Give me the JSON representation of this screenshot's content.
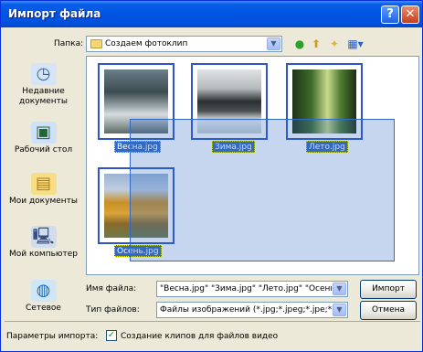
{
  "window": {
    "title": "Импорт файла"
  },
  "folder_row": {
    "label": "Папка:",
    "current_folder": "Создаем фотоклип"
  },
  "places": [
    {
      "label": "Недавние документы",
      "icon": "recent-documents-icon"
    },
    {
      "label": "Рабочий стол",
      "icon": "desktop-icon"
    },
    {
      "label": "Мои документы",
      "icon": "my-documents-icon"
    },
    {
      "label": "Мой компьютер",
      "icon": "my-computer-icon"
    },
    {
      "label": "Сетевое",
      "icon": "network-icon"
    }
  ],
  "files": [
    {
      "name": "Весна.jpg",
      "selected": true
    },
    {
      "name": "Зима.jpg",
      "selected": true
    },
    {
      "name": "Лето.jpg",
      "selected": true
    },
    {
      "name": "Осень.jpg",
      "selected": true
    }
  ],
  "form": {
    "filename_label": "Имя файла:",
    "filename_value": "\"Весна.jpg\" \"Зима.jpg\" \"Лето.jpg\" \"Осень.jp",
    "filetype_label": "Тип файлов:",
    "filetype_value": "Файлы изображений (*.jpg;*.jpeg;*.jpe;*.jfif;*.g"
  },
  "buttons": {
    "import": "Импорт",
    "cancel": "Отмена"
  },
  "import_params": {
    "label": "Параметры импорта:",
    "checkbox_label": "Создание клипов для файлов видео",
    "checked": true
  },
  "colors": {
    "titlebar": "#0054e3",
    "selection": "#316ac5",
    "dialog_bg": "#ece9d8"
  }
}
